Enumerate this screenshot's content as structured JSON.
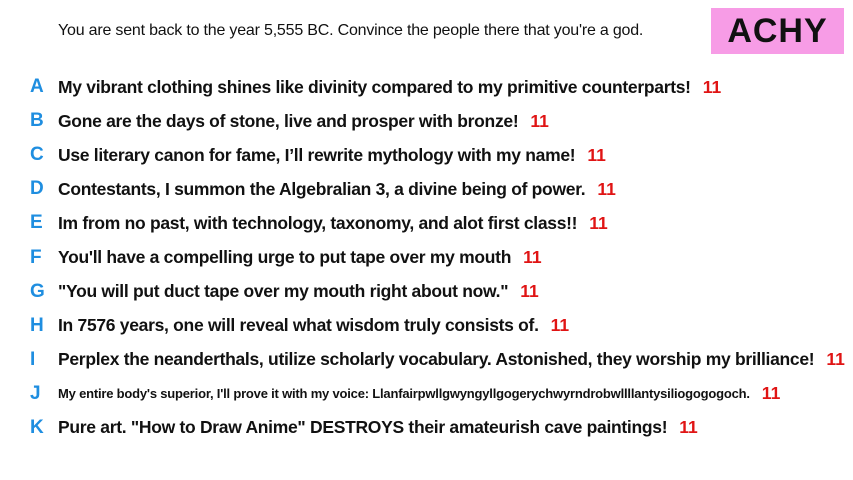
{
  "prompt": "You are sent back to the year 5,555 BC. Convince the people there that you're a god.",
  "badge": {
    "label": "ACHY",
    "background": "#f79ce6",
    "color": "#111111"
  },
  "colors": {
    "letter": "#1f8ee0",
    "score": "#e01414"
  },
  "answers": [
    {
      "letter": "A",
      "text": "My vibrant clothing shines like divinity compared to my primitive counterparts!",
      "score": "11"
    },
    {
      "letter": "B",
      "text": "Gone are the days of stone, live and prosper with bronze!",
      "score": "11"
    },
    {
      "letter": "C",
      "text": "Use literary canon for fame, I’ll rewrite mythology with my name!",
      "score": "11"
    },
    {
      "letter": "D",
      "text": "Contestants, I summon the Algebralian 3, a divine being of power.",
      "score": "11"
    },
    {
      "letter": "E",
      "text": "Im from no past, with technology, taxonomy, and alot first class!!",
      "score": "11"
    },
    {
      "letter": "F",
      "text": "You'll have a compelling urge to put tape over my mouth",
      "score": "11"
    },
    {
      "letter": "G",
      "text": "\"You will put duct tape over my mouth right about now.\"",
      "score": "11"
    },
    {
      "letter": "H",
      "text": "In 7576 years, one will reveal what wisdom truly consists of.",
      "score": "11"
    },
    {
      "letter": "I",
      "text": "Perplex the neanderthals, utilize scholarly vocabulary. Astonished, they worship my brilliance!",
      "score": "11"
    },
    {
      "letter": "J",
      "text": "My entire body's superior, I'll prove it with my voice: Llanfairpwllgwyngyllgogerychwyrndrobwllllantysiliogogogoch.",
      "score": "11"
    },
    {
      "letter": "K",
      "text": "Pure art. \"How to Draw Anime\" DESTROYS their amateurish cave paintings!",
      "score": "11"
    }
  ]
}
